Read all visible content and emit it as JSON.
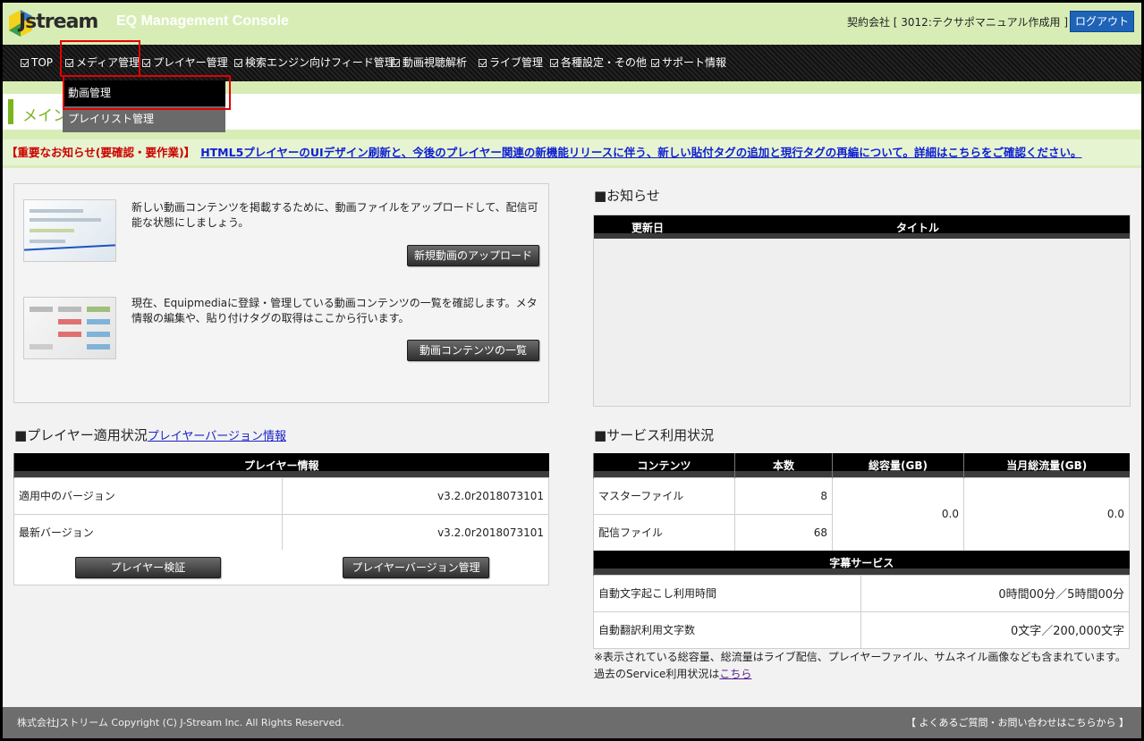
{
  "header": {
    "logo_text": "Jstream",
    "app_title": "EQ Management Console",
    "company": "契約会社 [ 3012:テクサポマニュアル作成用 ]",
    "logout_label": "ログアウト"
  },
  "nav": {
    "items": [
      {
        "label": "TOP"
      },
      {
        "label": "メディア管理"
      },
      {
        "label": "プレイヤー管理"
      },
      {
        "label": "検索エンジン向けフィード管理"
      },
      {
        "label": "動画視聴解析"
      },
      {
        "label": "ライブ管理"
      },
      {
        "label": "各種設定・その他"
      },
      {
        "label": "サポート情報"
      }
    ],
    "dropdown": [
      {
        "label": "動画管理"
      },
      {
        "label": "プレイリスト管理"
      }
    ]
  },
  "page_heading": "メイン",
  "notice": {
    "label": "【重要なお知らせ(要確認・要作業)】",
    "link": "HTML5プレイヤーのUIデザイン刷新と、今後のプレイヤー関連の新機能リリースに伴う、新しい貼付タグの追加と現行タグの再編について。詳細はこちらをご確認ください。"
  },
  "upload": {
    "desc1": "新しい動画コンテンツを掲載するために、動画ファイルをアップロードして、配信可能な状態にしましょう。",
    "button1": "新規動画のアップロード",
    "desc2": "現在、Equipmediaに登録・管理している動画コンテンツの一覧を確認します。メタ情報の編集や、貼り付けタグの取得はここから行います。",
    "button2": "動画コンテンツの一覧"
  },
  "news": {
    "title": "■お知らせ",
    "col_date": "更新日",
    "col_title": "タイトル"
  },
  "player": {
    "title": "■プレイヤー適用状況",
    "version_link": "プレイヤーバージョン情報",
    "table_header": "プレイヤー情報",
    "rows": [
      {
        "label": "適用中のバージョン",
        "value": "v3.2.0r2018073101"
      },
      {
        "label": "最新バージョン",
        "value": "v3.2.0r2018073101"
      }
    ],
    "btn_verify": "プレイヤー検証",
    "btn_manage": "プレイヤーバージョン管理"
  },
  "service": {
    "title": "■サービス利用状況",
    "headers": [
      "コンテンツ",
      "本数",
      "総容量(GB)",
      "当月総流量(GB)"
    ],
    "rows": [
      {
        "label": "マスターファイル",
        "count": "8"
      },
      {
        "label": "配信ファイル",
        "count": "68"
      }
    ],
    "total_capacity": "0.0",
    "monthly_traffic": "0.0",
    "subtitle_header": "字幕サービス",
    "subtitle_rows": [
      {
        "label": "自動文字起こし利用時間",
        "value": "0時間00分／5時間00分"
      },
      {
        "label": "自動翻訳利用文字数",
        "value": "0文字／200,000文字"
      }
    ],
    "note": "※表示されている総容量、総流量はライブ配信、プレイヤーファイル、サムネイル画像なども含まれています。",
    "past_prefix": "過去のService利用状況は",
    "past_link": "こちら"
  },
  "footer": {
    "copyright": "株式会社Jストリーム  Copyright (C) J-Stream Inc. All Rights Reserved.",
    "faq": "【 よくあるご質問・お問い合わせはこちらから 】"
  },
  "colors": {
    "header_bg": "#d8edb6",
    "accent_green": "#7ab51d",
    "logout_blue": "#1e63b8",
    "notice_red": "#cc0000",
    "highlight_red": "#e40000"
  }
}
